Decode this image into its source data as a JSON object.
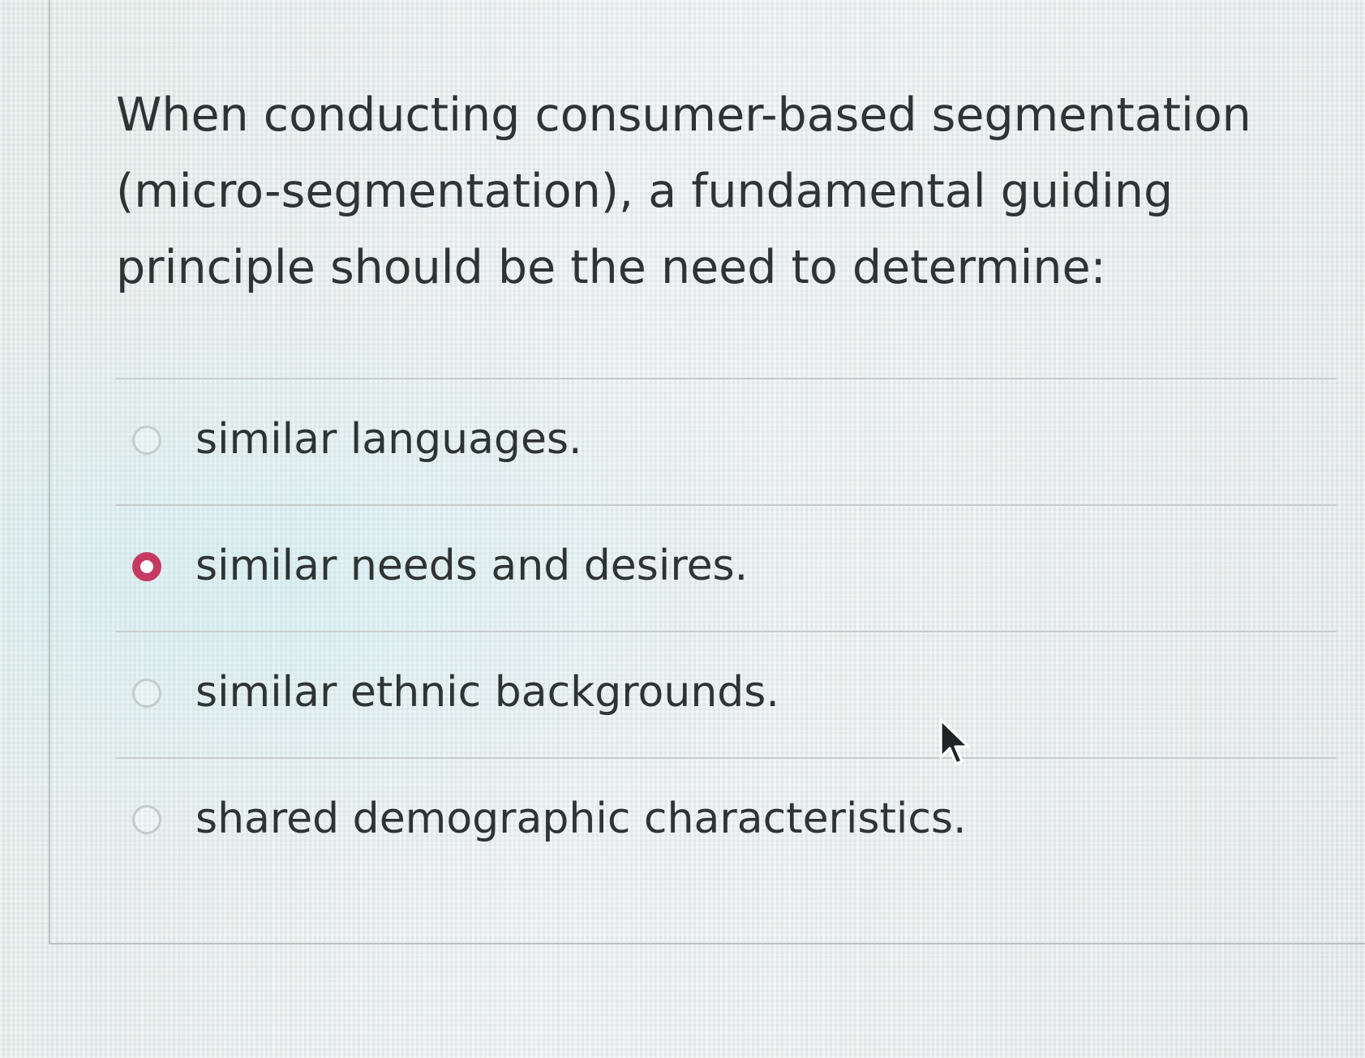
{
  "question": {
    "text": "When conducting consumer-based segmentation (micro-segmentation), a fundamental guiding principle should be the need to determine:"
  },
  "answers": [
    {
      "label": "similar languages.",
      "selected": false
    },
    {
      "label": "similar needs and desires.",
      "selected": true
    },
    {
      "label": "similar ethnic backgrounds.",
      "selected": false
    },
    {
      "label": "shared demographic characteristics.",
      "selected": false
    }
  ],
  "colors": {
    "accent": "#c53a63",
    "text": "#2e3433",
    "divider": "#c5cccb"
  },
  "icons": {
    "pointer": "mouse-pointer-icon",
    "radio": "radio-button-icon"
  }
}
